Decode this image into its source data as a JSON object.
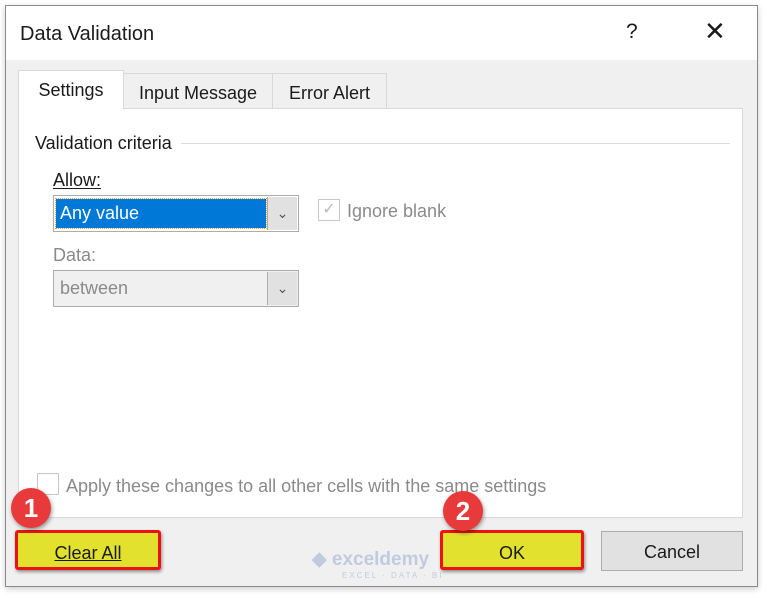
{
  "dialog": {
    "title": "Data Validation",
    "help_icon": "?",
    "close_icon": "✕"
  },
  "tabs": [
    {
      "label": "Settings",
      "active": true
    },
    {
      "label": "Input Message"
    },
    {
      "label": "Error Alert"
    }
  ],
  "settings": {
    "group_label": "Validation criteria",
    "allow_label": "Allow:",
    "allow_value": "Any value",
    "ignore_blank_label": "Ignore blank",
    "ignore_blank_checked": true,
    "data_label": "Data:",
    "data_value": "between",
    "apply_label": "Apply these changes to all other cells with the same settings",
    "apply_checked": false
  },
  "buttons": {
    "clear_all": "Clear All",
    "ok": "OK",
    "cancel": "Cancel"
  },
  "annotations": {
    "step1": "1",
    "step2": "2",
    "highlight_color": "#e2e22e",
    "border_color": "#ee1111"
  },
  "watermark": {
    "name": "exceldemy",
    "tagline": "EXCEL · DATA · BI"
  }
}
